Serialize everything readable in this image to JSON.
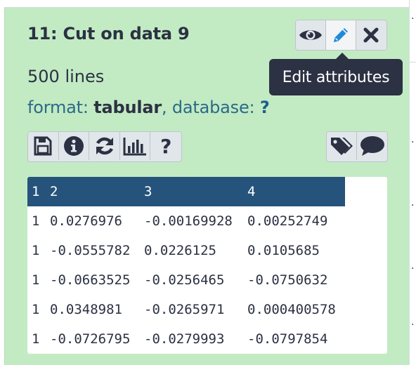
{
  "dataset": {
    "title": "11: Cut on data 9",
    "lines": "500 lines",
    "format_label": "format: ",
    "format_value": "tabular",
    "database_label": ", database: ",
    "database_value": "?"
  },
  "tooltip": {
    "text": "Edit attributes"
  },
  "title_buttons": [
    {
      "name": "display-button",
      "icon": "eye-icon"
    },
    {
      "name": "edit-attributes-button",
      "icon": "pencil-icon"
    },
    {
      "name": "delete-button",
      "icon": "x-icon"
    }
  ],
  "action_buttons": [
    {
      "name": "download-button",
      "icon": "floppy-disk-icon"
    },
    {
      "name": "dataset-details-button",
      "icon": "info-circle-icon"
    },
    {
      "name": "rerun-button",
      "icon": "sync-icon"
    },
    {
      "name": "visualize-button",
      "icon": "bar-chart-icon"
    },
    {
      "name": "help-button",
      "icon": "question-icon",
      "label": "?"
    }
  ],
  "tag_buttons": [
    {
      "name": "edit-tags-button",
      "icon": "tags-icon"
    },
    {
      "name": "annotation-button",
      "icon": "comment-icon"
    }
  ],
  "peek": {
    "headers": [
      "1",
      "2",
      "3",
      "4"
    ],
    "rows": [
      [
        "1",
        "0.0276976",
        "-0.00169928",
        "0.00252749"
      ],
      [
        "1",
        "-0.0555782",
        "0.0226125",
        "0.0105685"
      ],
      [
        "1",
        "-0.0663525",
        "-0.0256465",
        "-0.0750632"
      ],
      [
        "1",
        "0.0348981",
        "-0.0265971",
        "0.000400578"
      ],
      [
        "1",
        "-0.0726795",
        "-0.0279993",
        "-0.0797854"
      ]
    ]
  },
  "colors": {
    "panel_bg": "#c2ebc3",
    "header_bg": "#25537b",
    "tooltip_bg": "#2c3143",
    "accent_blue": "#1d8ad6"
  }
}
